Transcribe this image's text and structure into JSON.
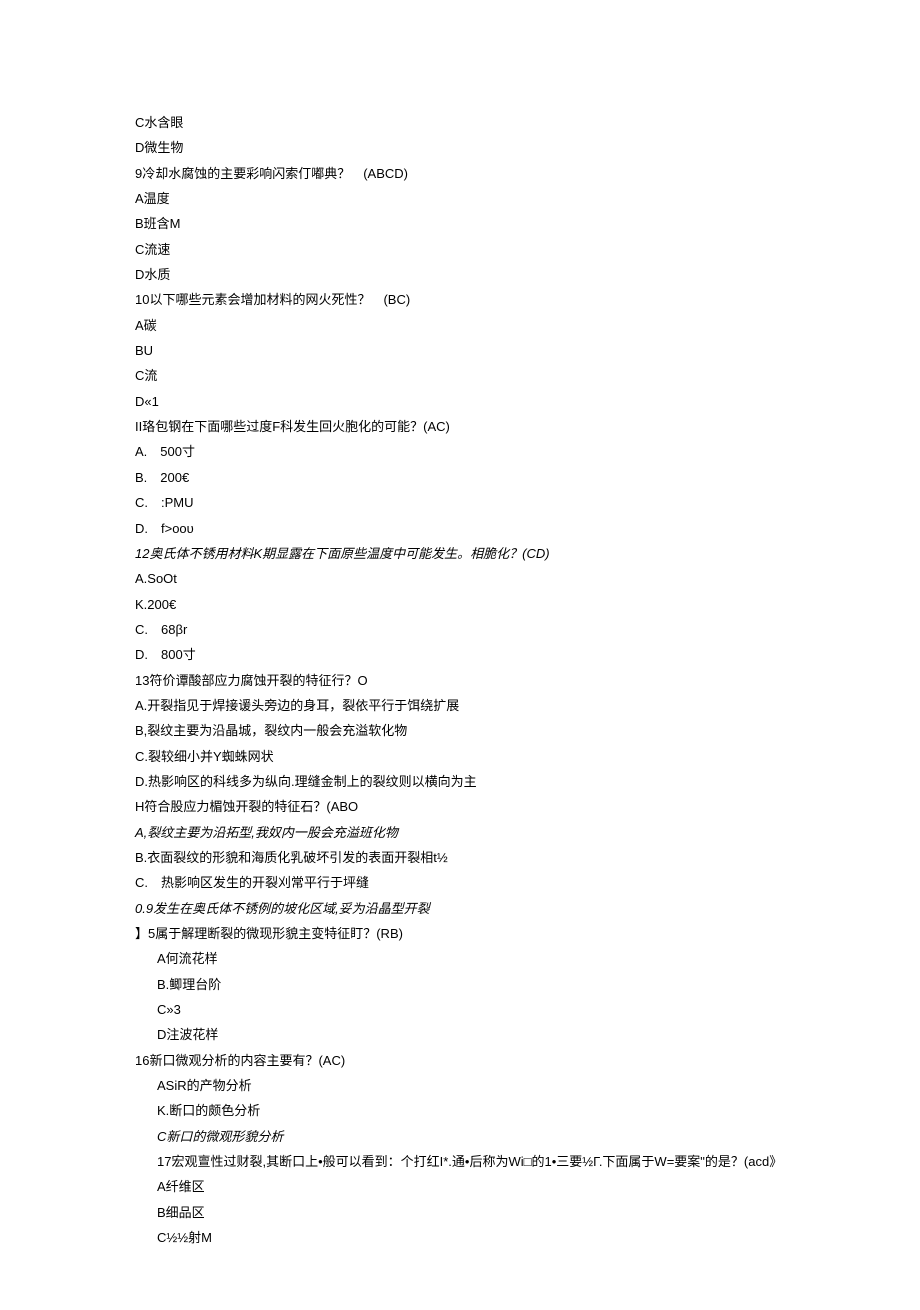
{
  "lines": [
    {
      "cls": "line",
      "text": "C水含眼"
    },
    {
      "cls": "line",
      "text": "D微生物"
    },
    {
      "cls": "line",
      "text": "9冷却水腐蚀的主要彩响闪索仃嘟典？　(ABCD)"
    },
    {
      "cls": "line",
      "text": "A温度"
    },
    {
      "cls": "line",
      "text": "B班含M"
    },
    {
      "cls": "line",
      "text": "C流速"
    },
    {
      "cls": "line",
      "text": "D水质"
    },
    {
      "cls": "line",
      "text": "10以下哪些元素会增加材料的网火死性？　(BC)"
    },
    {
      "cls": "line",
      "text": "A碳"
    },
    {
      "cls": "line",
      "text": "BU"
    },
    {
      "cls": "line",
      "text": "C流"
    },
    {
      "cls": "line",
      "text": "D«1"
    },
    {
      "cls": "line",
      "text": "II珞包钢在下面哪些过度F科发生回火胞化的可能？(AC)"
    },
    {
      "cls": "line",
      "text": "A.　500寸"
    },
    {
      "cls": "line",
      "text": "B.　200€"
    },
    {
      "cls": "line",
      "text": "C.　:PMU"
    },
    {
      "cls": "line",
      "text": "D.　f>ooυ"
    },
    {
      "cls": "line italic",
      "text": "12奥氏体不锈用材料K期显露在下面原些温度中可能发生。相脆化？(CD)"
    },
    {
      "cls": "line",
      "text": "A.SoOt"
    },
    {
      "cls": "line",
      "text": "K.200€"
    },
    {
      "cls": "line",
      "text": "C.　68βr"
    },
    {
      "cls": "line",
      "text": "D.　800寸"
    },
    {
      "cls": "line",
      "text": "13符价谭酸部应力腐蚀开裂的特征行？O"
    },
    {
      "cls": "line",
      "text": "A.开裂指见于焊接谖头旁边的身耳，裂依平行于饵绕扩展"
    },
    {
      "cls": "line",
      "text": "B,裂纹主要为沿晶城，裂纹内一般会充溢软化物"
    },
    {
      "cls": "line",
      "text": "C.裂较细小并Y蜘蛛网状"
    },
    {
      "cls": "line",
      "text": "D.热影响区的科线多为纵向.理缝金制上的裂纹则以横向为主"
    },
    {
      "cls": "line",
      "text": "H符合股应力楣蚀开裂的特征石？(ABO"
    },
    {
      "cls": "line italic",
      "text": "A,裂纹主要为沿拓型,我奴内一股会充溢班化物"
    },
    {
      "cls": "line",
      "text": "B.衣面裂纹的形貌和海质化乳破坏引发的表面开裂相t½"
    },
    {
      "cls": "line",
      "text": "C.　热影响区发生的开裂刈常平行于坪缝"
    },
    {
      "cls": "line italic",
      "text": "0.9发生在奥氏体不锈例的坡化区域,妥为沿晶型开裂"
    },
    {
      "cls": "line",
      "text": "】5属于解理断裂的微现形貌主变特征盯？(RB)"
    },
    {
      "cls": "line indent",
      "text": "A何流花样"
    },
    {
      "cls": "line indent",
      "text": "B.鲫理台阶"
    },
    {
      "cls": "line indent",
      "text": "C»3"
    },
    {
      "cls": "line indent",
      "text": "D注波花样"
    },
    {
      "cls": "line",
      "text": "16新口微观分析的内容主要有？(AC)"
    },
    {
      "cls": "line indent",
      "text": "ASiR的产物分析"
    },
    {
      "cls": "line indent",
      "text": "K.断口的颇色分析"
    },
    {
      "cls": "line indent italic",
      "text": "C新口的微观形貌分析"
    },
    {
      "cls": "line indent",
      "text": "17宏观亶性过财裂,其断口上•般可以看到：个打红I*.通•后称为Wi□的1•三要½Γ.下面属于W=要案\"的是？(acd》"
    },
    {
      "cls": "line indent",
      "text": "A纤维区"
    },
    {
      "cls": "line indent",
      "text": "B细品区"
    },
    {
      "cls": "line indent",
      "text": "C½½射M"
    }
  ]
}
